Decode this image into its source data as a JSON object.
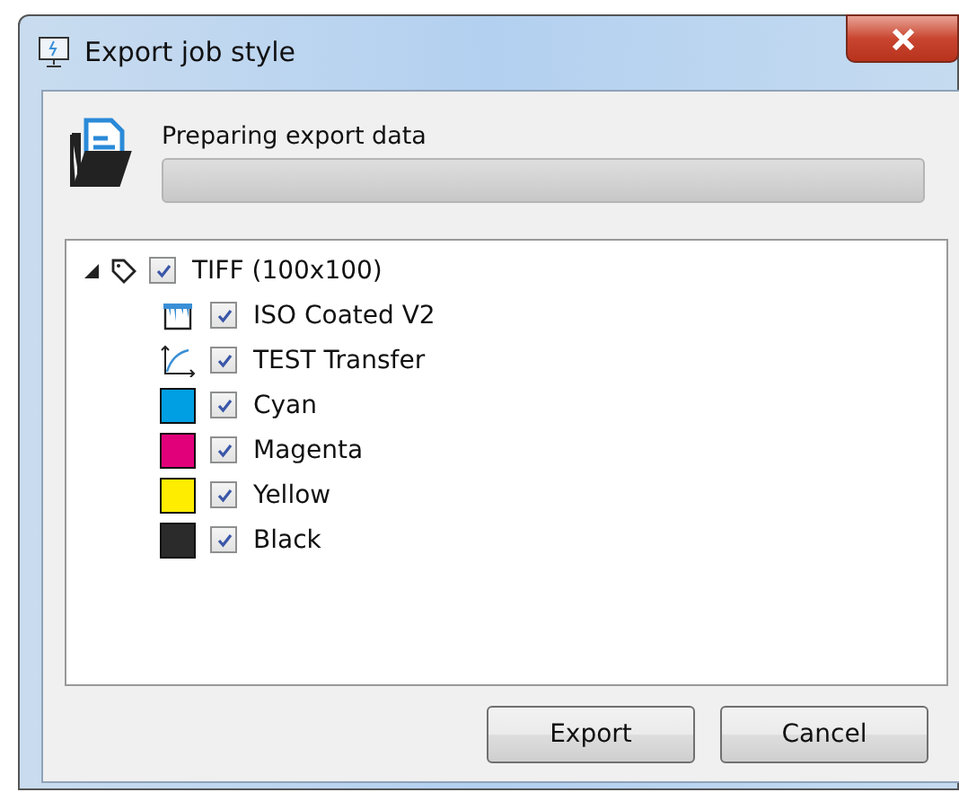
{
  "window": {
    "title": "Export job style"
  },
  "progress": {
    "label": "Preparing export data",
    "level": 0
  },
  "tree": [
    {
      "label": "TIFF (100x100)",
      "checked": true,
      "expanded": true,
      "children": [
        {
          "kind": "profile",
          "label": "ISO Coated V2",
          "checked": true
        },
        {
          "kind": "curve",
          "label": "TEST Transfer",
          "checked": true
        },
        {
          "kind": "swatch",
          "label": "Cyan",
          "checked": true,
          "color": "#009fe3"
        },
        {
          "kind": "swatch",
          "label": "Magenta",
          "checked": true,
          "color": "#e2007a"
        },
        {
          "kind": "swatch",
          "label": "Yellow",
          "checked": true,
          "color": "#ffed00"
        },
        {
          "kind": "swatch",
          "label": "Black",
          "checked": true,
          "color": "#2b2b2b"
        }
      ]
    }
  ],
  "buttons": [
    {
      "label": "Export"
    },
    {
      "label": "Cancel"
    }
  ]
}
